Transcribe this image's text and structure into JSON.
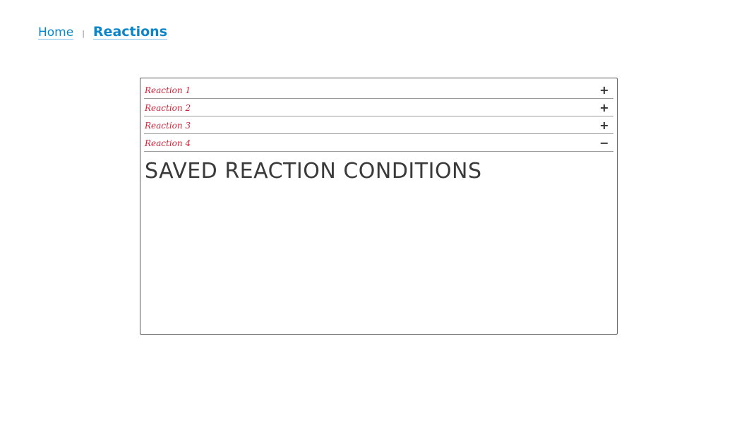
{
  "breadcrumb": {
    "home": "Home",
    "separator": "|",
    "current": "Reactions"
  },
  "accordion": {
    "items": [
      {
        "label": "Reaction 1",
        "toggle": "+",
        "expanded": false
      },
      {
        "label": "Reaction 2",
        "toggle": "+",
        "expanded": false
      },
      {
        "label": "Reaction 3",
        "toggle": "+",
        "expanded": false
      },
      {
        "label": "Reaction 4",
        "toggle": "−",
        "expanded": true
      }
    ],
    "expanded_content": {
      "heading": "SAVED REACTION CONDITIONS"
    }
  },
  "colors": {
    "link": "#0a86c9",
    "accordion_label": "#d0243a",
    "border": "#555555",
    "heading": "#3a3a3a"
  }
}
